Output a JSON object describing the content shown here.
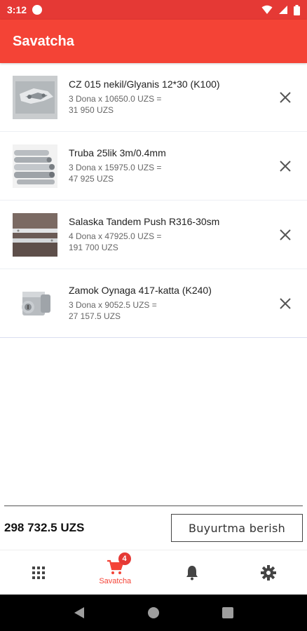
{
  "status_bar": {
    "time": "3:12"
  },
  "app_bar": {
    "title": "Savatcha"
  },
  "cart": {
    "items": [
      {
        "name": "CZ 015 nekil/Glyanis 12*30 (K100)",
        "detail_line1": "3 Dona x 10650.0 UZS =",
        "detail_line2": "31 950 UZS",
        "image": "hinge-photo"
      },
      {
        "name": "Truba 25lik 3m/0.4mm",
        "detail_line1": "3 Dona x 15975.0 UZS =",
        "detail_line2": "47 925 UZS",
        "image": "metal-pipes-photo"
      },
      {
        "name": "Salaska Tandem Push R316-30sm",
        "detail_line1": "4 Dona x 47925.0 UZS =",
        "detail_line2": "191 700 UZS",
        "image": "drawer-slide-photo"
      },
      {
        "name": "Zamok Oynaga 417-katta (K240)",
        "detail_line1": "3 Dona x 9052.5 UZS =",
        "detail_line2": "27 157.5 UZS",
        "image": "glass-lock-photo"
      }
    ]
  },
  "footer": {
    "total": "298 732.5 UZS",
    "order_button": "Buyurtma berish"
  },
  "bottom_nav": {
    "items": [
      {
        "icon": "grid-icon",
        "label": ""
      },
      {
        "icon": "cart-icon",
        "label": "Savatcha",
        "badge": "4",
        "active": true
      },
      {
        "icon": "bell-icon",
        "label": ""
      },
      {
        "icon": "gear-icon",
        "label": ""
      }
    ]
  },
  "colors": {
    "accent": "#f44336",
    "status_bar": "#e53935"
  }
}
